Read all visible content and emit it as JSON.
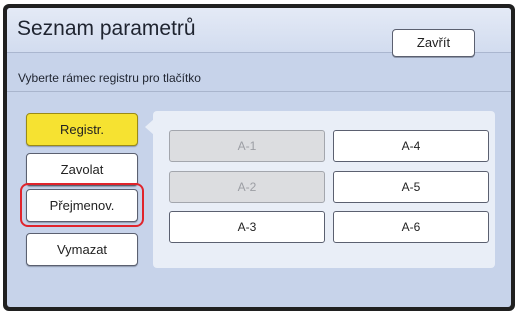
{
  "header": {
    "title": "Seznam parametrů",
    "close_label": "Zavřít"
  },
  "instruction": "Vyberte rámec registru pro tlačítko",
  "actions": [
    {
      "label": "Registr.",
      "active": true
    },
    {
      "label": "Zavolat",
      "active": false
    },
    {
      "label": "Přejmenov.",
      "active": false,
      "highlighted": true
    },
    {
      "label": "Vymazat",
      "active": false
    }
  ],
  "slots": [
    {
      "label": "A-1",
      "enabled": false
    },
    {
      "label": "A-2",
      "enabled": false
    },
    {
      "label": "A-3",
      "enabled": true
    },
    {
      "label": "A-4",
      "enabled": true
    },
    {
      "label": "A-5",
      "enabled": true
    },
    {
      "label": "A-6",
      "enabled": true
    }
  ],
  "colors": {
    "panel_bg": "#c7d3ea",
    "active_button": "#f6e231",
    "highlight_ring": "#e0242c",
    "disabled_slot": "#dcdde0"
  }
}
